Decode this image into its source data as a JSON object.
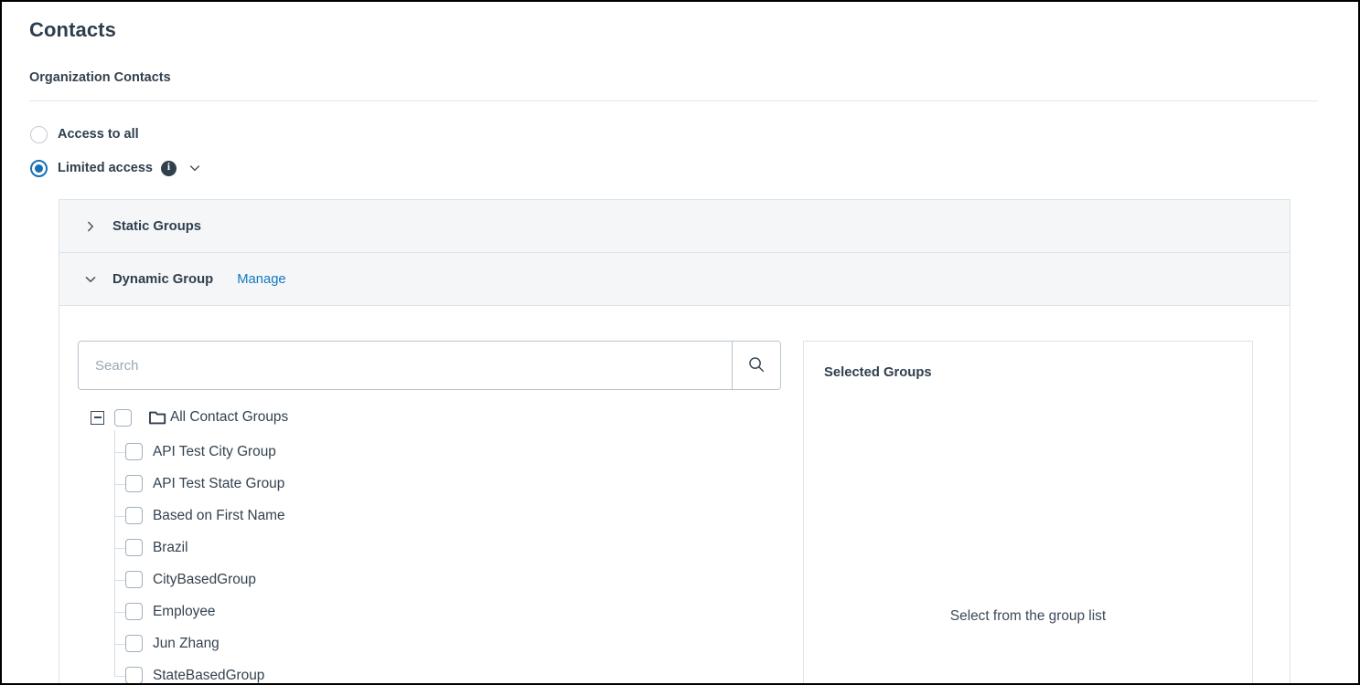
{
  "page": {
    "title": "Contacts",
    "subtitle": "Organization Contacts"
  },
  "access_options": [
    {
      "label": "Access to all",
      "selected": false
    },
    {
      "label": "Limited access",
      "selected": true,
      "info_icon": "info-icon",
      "chevron": "chevron-down-icon"
    }
  ],
  "accordions": [
    {
      "title": "Static Groups",
      "expanded": false,
      "chevron": "chevron-right-icon"
    },
    {
      "title": "Dynamic Group",
      "expanded": true,
      "chevron": "chevron-down-icon",
      "link": "Manage"
    }
  ],
  "search": {
    "placeholder": "Search",
    "value": "",
    "button_icon": "search-icon"
  },
  "tree": {
    "root": {
      "label": "All Contact Groups",
      "expander_icon": "minus-square-icon",
      "folder_icon": "folder-icon",
      "checked": false
    },
    "items": [
      {
        "label": "API Test City Group",
        "checked": false
      },
      {
        "label": "API Test State Group",
        "checked": false
      },
      {
        "label": "Based on First Name",
        "checked": false
      },
      {
        "label": "Brazil",
        "checked": false
      },
      {
        "label": "CityBasedGroup",
        "checked": false
      },
      {
        "label": "Employee",
        "checked": false
      },
      {
        "label": "Jun Zhang",
        "checked": false
      },
      {
        "label": "StateBasedGroup",
        "checked": false
      }
    ]
  },
  "selected_panel": {
    "title": "Selected Groups",
    "empty_message": "Select from the group list"
  },
  "colors": {
    "accent_blue": "#1570b5",
    "link_blue": "#1379bf",
    "text_dark": "#2f3e4d",
    "panel_bg": "#f4f6f8",
    "border": "#dde3e8"
  }
}
